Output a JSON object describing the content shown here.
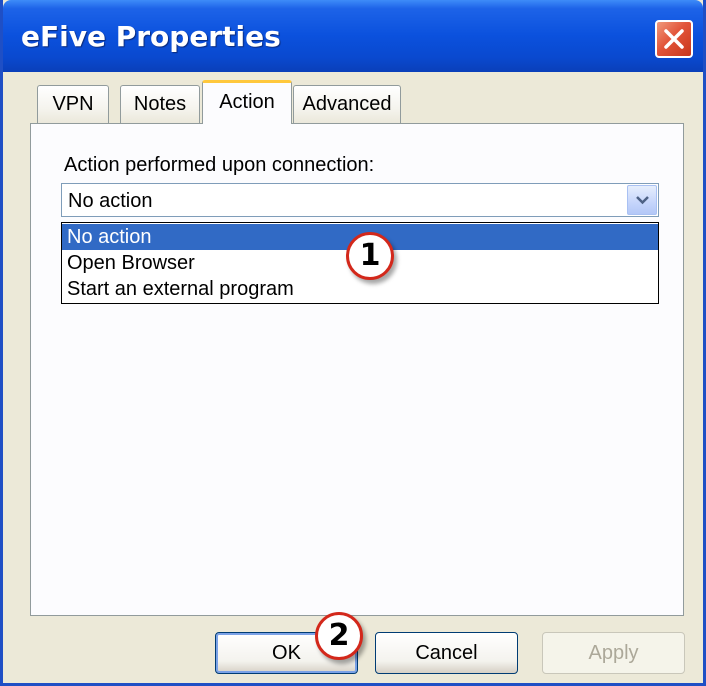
{
  "window": {
    "title": "eFive Properties"
  },
  "tabs": [
    {
      "label": "VPN",
      "active": false
    },
    {
      "label": "Notes",
      "active": false
    },
    {
      "label": "Action",
      "active": true
    },
    {
      "label": "Advanced",
      "active": false
    }
  ],
  "action_panel": {
    "label": "Action performed upon connection:",
    "combo_value": "No action",
    "options": [
      "No action",
      "Open Browser",
      "Start an external program"
    ],
    "selected_option": "No action"
  },
  "callouts": [
    "1",
    "2"
  ],
  "buttons": {
    "ok": "OK",
    "cancel": "Cancel",
    "apply": "Apply"
  },
  "colors": {
    "titlebar": "#0b51dd",
    "selection": "#316ac5",
    "callout_border": "#d3281b",
    "active_tab_accent": "#ffc83c"
  }
}
